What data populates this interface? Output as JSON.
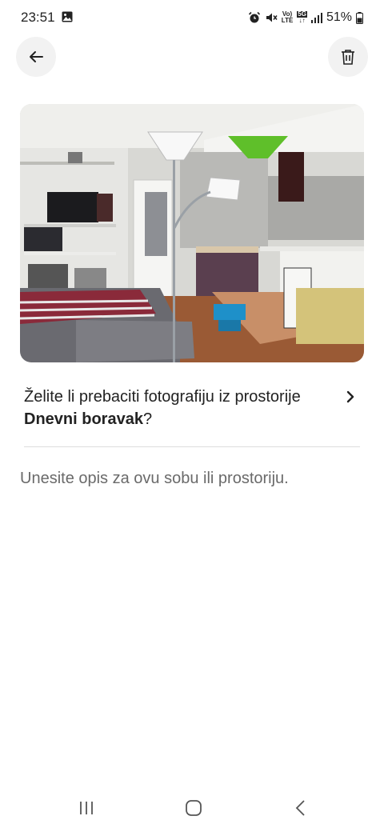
{
  "status_bar": {
    "time": "23:51",
    "network_top": "Vo)",
    "network_bottom": "LTE",
    "gen_top": "5G",
    "gen_bottom": "↓↑",
    "battery": "51%",
    "icons": [
      "image-icon",
      "alarm-icon",
      "mute-icon",
      "volte-icon",
      "5g-icon",
      "signal-icon",
      "battery-icon"
    ]
  },
  "header": {
    "back_icon": "arrow-left-icon",
    "delete_icon": "trash-icon"
  },
  "photo": {
    "description": "living room photo"
  },
  "move_photo": {
    "prefix": "Želite li prebaciti fotografiju iz prostorije ",
    "room_name": "Dnevni boravak",
    "suffix": "?",
    "icon": "chevron-right-icon"
  },
  "description": {
    "placeholder": "Unesite opis za ovu sobu ili prostoriju."
  },
  "nav_bar": {
    "icons": [
      "recents-icon",
      "home-icon",
      "back-icon"
    ]
  },
  "colors": {
    "circle_bg": "#f2f2f2",
    "text": "#222222",
    "muted": "#6a6a6a",
    "divider": "#dddddd"
  }
}
